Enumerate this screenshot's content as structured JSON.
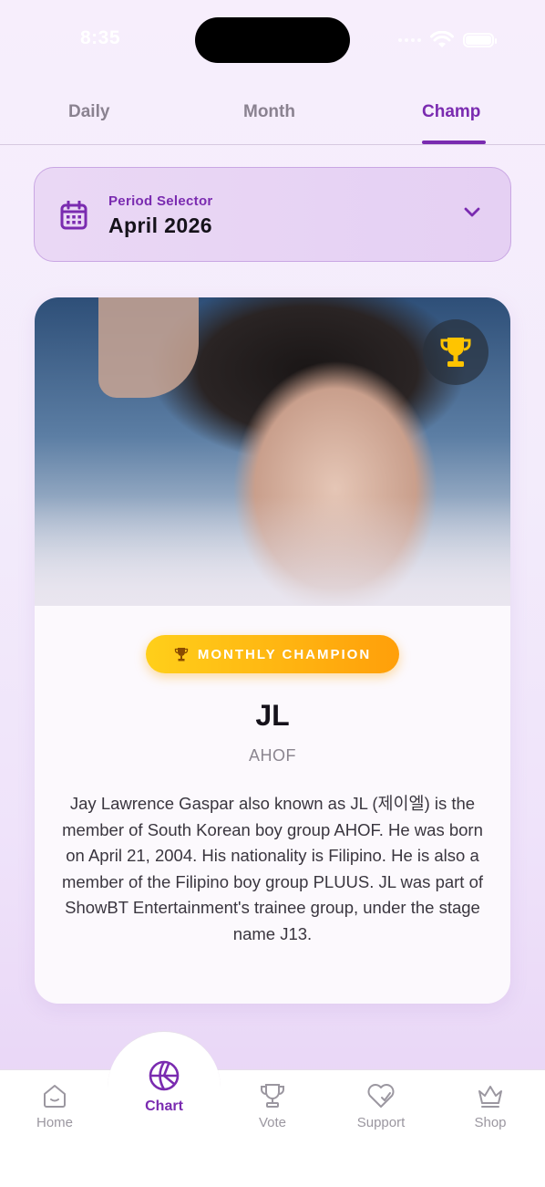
{
  "status": {
    "time": "8:35"
  },
  "tabs": [
    {
      "label": "Daily"
    },
    {
      "label": "Month"
    },
    {
      "label": "Champ"
    }
  ],
  "period": {
    "label": "Period Selector",
    "value": "April 2026"
  },
  "champion": {
    "badge": "MONTHLY CHAMPION",
    "name": "JL",
    "group": "AHOF",
    "bio": "Jay Lawrence Gaspar also known as JL (제이엘) is the member of South Korean boy group AHOF. He was born on April 21, 2004. His nationality is Filipino. He is also a member of the Filipino boy group PLUUS. JL was part of ShowBT Entertainment's trainee group, under the stage name J13."
  },
  "nav": [
    {
      "label": "Home",
      "icon": "home-icon"
    },
    {
      "label": "Chart",
      "icon": "chart-icon"
    },
    {
      "label": "Vote",
      "icon": "trophy-icon"
    },
    {
      "label": "Support",
      "icon": "heart-icon"
    },
    {
      "label": "Shop",
      "icon": "crown-icon"
    }
  ],
  "colors": {
    "accent": "#7a2bb0",
    "badge_start": "#ffcf1a",
    "badge_end": "#ff9f0a"
  }
}
